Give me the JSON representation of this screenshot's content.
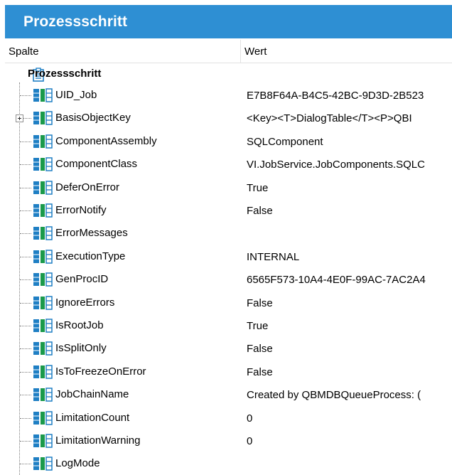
{
  "window": {
    "title": "Prozessschritt"
  },
  "columns": {
    "name": "Spalte",
    "value": "Wert"
  },
  "root": {
    "label": "Prozessschritt",
    "icon": "clipboard-icon"
  },
  "colors": {
    "titlebar": "#2e8fd3",
    "icon_blue": "#1f7fc4",
    "icon_green": "#1a9a4b"
  },
  "properties": [
    {
      "name": "UID_Job",
      "value": "E7B8F64A-B4C5-42BC-9D3D-2B523",
      "expandable": false
    },
    {
      "name": "BasisObjectKey",
      "value": "<Key><T>DialogTable</T><P>QBI",
      "expandable": true
    },
    {
      "name": "ComponentAssembly",
      "value": "SQLComponent",
      "expandable": false
    },
    {
      "name": "ComponentClass",
      "value": "VI.JobService.JobComponents.SQLC",
      "expandable": false
    },
    {
      "name": "DeferOnError",
      "value": "True",
      "expandable": false
    },
    {
      "name": "ErrorNotify",
      "value": "False",
      "expandable": false
    },
    {
      "name": "ErrorMessages",
      "value": "",
      "expandable": false
    },
    {
      "name": "ExecutionType",
      "value": "INTERNAL",
      "expandable": false
    },
    {
      "name": "GenProcID",
      "value": "6565F573-10A4-4E0F-99AC-7AC2A4",
      "expandable": false
    },
    {
      "name": "IgnoreErrors",
      "value": "False",
      "expandable": false
    },
    {
      "name": "IsRootJob",
      "value": "True",
      "expandable": false
    },
    {
      "name": "IsSplitOnly",
      "value": "False",
      "expandable": false
    },
    {
      "name": "IsToFreezeOnError",
      "value": "False",
      "expandable": false
    },
    {
      "name": "JobChainName",
      "value": "Created by QBMDBQueueProcess: (",
      "expandable": false
    },
    {
      "name": "LimitationCount",
      "value": "0",
      "expandable": false
    },
    {
      "name": "LimitationWarning",
      "value": "0",
      "expandable": false
    },
    {
      "name": "LogMode",
      "value": "",
      "expandable": false
    }
  ]
}
